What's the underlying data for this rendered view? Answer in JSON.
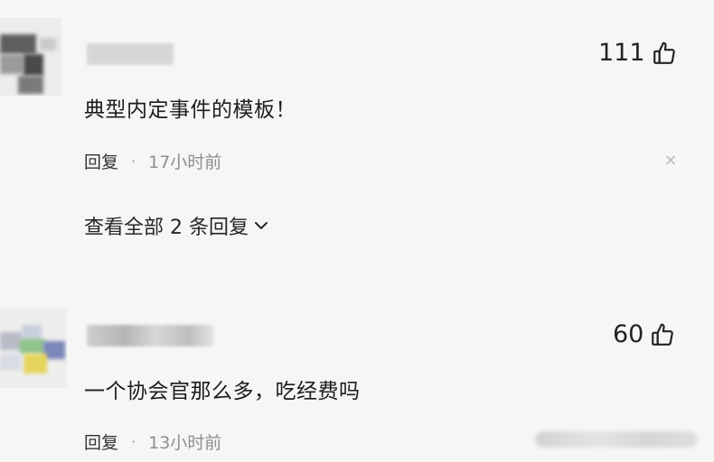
{
  "comments": [
    {
      "likes": "111",
      "text": "典型内定事件的模板！",
      "reply_label": "回复",
      "separator": "·",
      "time": "17小时前",
      "view_all": "查看全部 2 条回复",
      "close_icon": "close-icon",
      "like_icon": "thumbs-up-icon"
    },
    {
      "likes": "60",
      "text": "一个协会官那么多，吃经费吗",
      "reply_label": "回复",
      "separator": "·",
      "time": "13小时前",
      "like_icon": "thumbs-up-icon"
    }
  ],
  "colors": {
    "background": "#f6f6f6",
    "text_primary": "#1d1d1d",
    "text_secondary": "#8e8e8e"
  }
}
